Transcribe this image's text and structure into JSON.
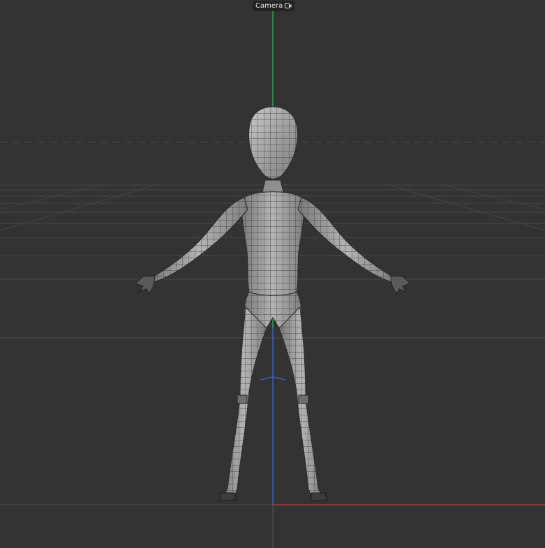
{
  "viewport": {
    "camera_label": "Camera",
    "camera_icon": "camera-icon",
    "colors": {
      "background": "#333333",
      "grid": "#4a4a4a",
      "horizon": "#555555",
      "axis_y": "#3bb84f",
      "axis_z": "#3d6bd4",
      "axis_x": "#c83c3c",
      "mesh_fill": "#9a9a9a",
      "mesh_wire": "#2a2a2a"
    },
    "model": "character-mesh"
  }
}
